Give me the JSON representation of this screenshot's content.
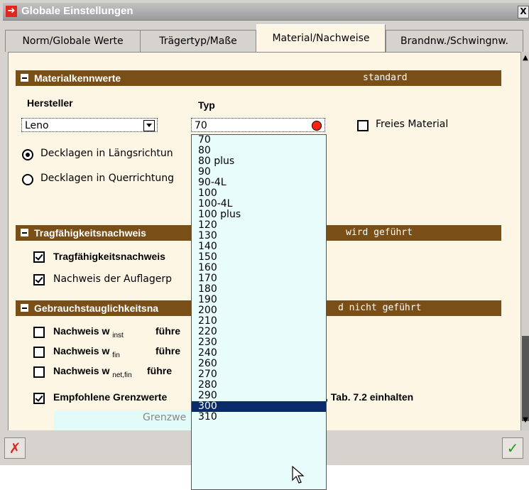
{
  "window": {
    "title": "Globale Einstellungen",
    "close_label": "X"
  },
  "tabs": [
    {
      "label": "Norm/Globale Werte"
    },
    {
      "label": "Trägertyp/Maße"
    },
    {
      "label": "Material/Nachweise"
    },
    {
      "label": "Brandnw./Schwingnw."
    }
  ],
  "material": {
    "title": "Materialkennwerte",
    "status": "standard",
    "hersteller_label": "Hersteller",
    "typ_label": "Typ",
    "hersteller_value": "Leno",
    "typ_value": "70",
    "freies_material": "Freies Material",
    "decklagen_laengs": "Decklagen in Längsrichtun",
    "decklagen_quer": "Decklagen in Querrichtung"
  },
  "trag": {
    "title": "Tragfähigkeitsnachweis",
    "status": "wird geführt",
    "check1": "Tragfähigkeitsnachweis",
    "check2": "Nachweis der Auflagerp"
  },
  "gebrauch": {
    "title": "Gebrauchstauglichkeitsna",
    "status": "d nicht geführt",
    "w_label": "Nachweis w",
    "sub_inst": "inst",
    "sub_fin": "fin",
    "sub_netfin": "net,fin",
    "fuehren": "führe",
    "empfohlen": "Empfohlene Grenzwerte",
    "tab_text": ", Tab. 7.2 einhalten",
    "grenz": "Grenzwe"
  },
  "typ_options": [
    "70",
    "80",
    "80 plus",
    "90",
    "90-4L",
    "100",
    "100-4L",
    "100 plus",
    "120",
    "130",
    "140",
    "150",
    "160",
    "170",
    "180",
    "190",
    "200",
    "210",
    "220",
    "230",
    "240",
    "260",
    "270",
    "280",
    "290",
    "300",
    "310"
  ],
  "selected_option_index": 25,
  "buttons": {
    "cancel": "✗",
    "ok": "✓"
  }
}
